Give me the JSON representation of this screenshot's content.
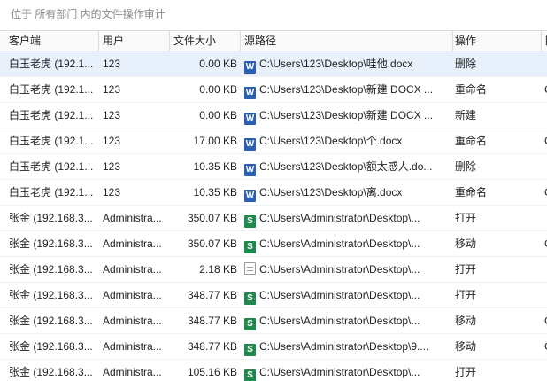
{
  "caption": "位于 所有部门 内的文件操作审计",
  "columns": {
    "client": "客户端",
    "user": "用户",
    "size": "文件大小",
    "path": "源路径",
    "op": "操作",
    "extra": "目"
  },
  "rows": [
    {
      "client": "白玉老虎 (192.1...",
      "user": "123",
      "size": "0.00 KB",
      "icon": "word",
      "path": "C:\\Users\\123\\Desktop\\哇他.docx",
      "op": "删除",
      "extra": ""
    },
    {
      "client": "白玉老虎 (192.1...",
      "user": "123",
      "size": "0.00 KB",
      "icon": "word",
      "path": "C:\\Users\\123\\Desktop\\新建 DOCX ...",
      "op": "重命名",
      "extra": "C"
    },
    {
      "client": "白玉老虎 (192.1...",
      "user": "123",
      "size": "0.00 KB",
      "icon": "word",
      "path": "C:\\Users\\123\\Desktop\\新建 DOCX ...",
      "op": "新建",
      "extra": ""
    },
    {
      "client": "白玉老虎 (192.1...",
      "user": "123",
      "size": "17.00 KB",
      "icon": "word",
      "path": "C:\\Users\\123\\Desktop\\个.docx",
      "op": "重命名",
      "extra": "C"
    },
    {
      "client": "白玉老虎 (192.1...",
      "user": "123",
      "size": "10.35 KB",
      "icon": "word",
      "path": "C:\\Users\\123\\Desktop\\额太感人.do...",
      "op": "删除",
      "extra": ""
    },
    {
      "client": "白玉老虎 (192.1...",
      "user": "123",
      "size": "10.35 KB",
      "icon": "word",
      "path": "C:\\Users\\123\\Desktop\\离.docx",
      "op": "重命名",
      "extra": "C"
    },
    {
      "client": "张金 (192.168.3...",
      "user": "Administra...",
      "size": "350.07 KB",
      "icon": "excel",
      "path": "C:\\Users\\Administrator\\Desktop\\...",
      "op": "打开",
      "extra": ""
    },
    {
      "client": "张金 (192.168.3...",
      "user": "Administra...",
      "size": "350.07 KB",
      "icon": "excel",
      "path": "C:\\Users\\Administrator\\Desktop\\...",
      "op": "移动",
      "extra": "C"
    },
    {
      "client": "张金 (192.168.3...",
      "user": "Administra...",
      "size": "2.18 KB",
      "icon": "txt",
      "path": "C:\\Users\\Administrator\\Desktop\\...",
      "op": "打开",
      "extra": ""
    },
    {
      "client": "张金 (192.168.3...",
      "user": "Administra...",
      "size": "348.77 KB",
      "icon": "excel",
      "path": "C:\\Users\\Administrator\\Desktop\\...",
      "op": "打开",
      "extra": ""
    },
    {
      "client": "张金 (192.168.3...",
      "user": "Administra...",
      "size": "348.77 KB",
      "icon": "excel",
      "path": "C:\\Users\\Administrator\\Desktop\\...",
      "op": "移动",
      "extra": "C"
    },
    {
      "client": "张金 (192.168.3...",
      "user": "Administra...",
      "size": "348.77 KB",
      "icon": "excel",
      "path": "C:\\Users\\Administrator\\Desktop\\9....",
      "op": "移动",
      "extra": "C"
    },
    {
      "client": "张金 (192.168.3...",
      "user": "Administra...",
      "size": "105.16 KB",
      "icon": "excel",
      "path": "C:\\Users\\Administrator\\Desktop\\...",
      "op": "打开",
      "extra": ""
    }
  ],
  "icons": {
    "word": "W",
    "excel": "S",
    "txt": ""
  }
}
